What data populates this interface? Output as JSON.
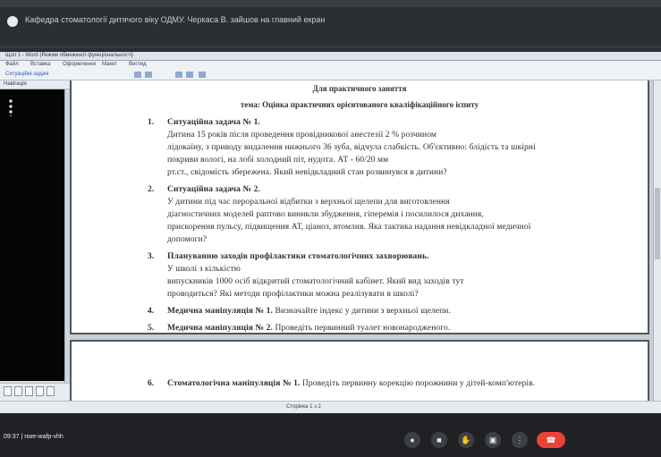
{
  "banner": {
    "text": "Кафедра стоматології дитячого віку ОДМУ. Черкаса В. зайшов на главний екран"
  },
  "window": {
    "title": "Щоп 1 - Word (Режим обмеженої функціональності)",
    "menu": [
      "Файл",
      "Вставка",
      "Оформлення",
      "Макет",
      "Вигляд"
    ],
    "toolbar_text": "Ситуаційні задачі",
    "side_header": "Навігація",
    "status_text": "Сторінка 1 з 2"
  },
  "document": {
    "page1_header_top": "Для практичного заняття",
    "page1_header": "тема: Оцінка практичних орієнтованого кваліфікаційного іспиту",
    "tasks": [
      {
        "num": "1.",
        "title": "Ситуаційна задача № 1.",
        "lines": [
          "Дитина 15 років після проведення провідникової анестезії 2 % розчином",
          "лідокаїну, з приводу видалення нижнього 36 зуба, відчула слабкість. Об'єктивно: блідість та шкірні",
          "покриви вологі, на лобі холодний піт, нудота. АТ - 60/20 мм",
          "рт.ст., свідомість збережена. Який невідкладний стан розвинувся в дитини?"
        ]
      },
      {
        "num": "2.",
        "title": "Ситуаційна задача № 2.",
        "lines": [
          "У дитини під час пероральної відбитки з верхньої щелепи для виготовлення",
          "діагностичних моделей раптово виникли збудження, гіперемія і посилилося дихання,",
          "прискорення пульсу, підвищення АТ, ціаноз, втомлив. Яка тактика надання невідкладної медичної",
          "допомоги?"
        ]
      },
      {
        "num": "3.",
        "title": "Плануванню заходів профілактики стоматологічних захворювань.",
        "lines": [
          "У школі з кількістю",
          "випускників 1000 осіб відкритий стоматологічний кабінет. Який вид заходів тут",
          "проводиться? Які методи профілактики можна реалізувати в школі?"
        ]
      },
      {
        "num": "4.",
        "title": "Медична маніпуляція № 1.",
        "lines": [
          "Визначайте індекс у дитини з верхньої щелепи."
        ]
      },
      {
        "num": "5.",
        "title": "Медична маніпуляція № 2.",
        "lines": [
          "Проведіть первинний туалет новонародженого."
        ]
      }
    ],
    "page2_tasks": [
      {
        "num": "6.",
        "title": "Стоматологічна маніпуляція № 1.",
        "lines": [
          "Проведіть первинну корекцію порожнини у дітей-комп'ютерів."
        ]
      }
    ]
  },
  "meeting": {
    "time_label": "09:37",
    "meeting_code": "nwe-wafp-vhh"
  },
  "controls": [
    {
      "name": "mic-button",
      "icon": "microphone-icon"
    },
    {
      "name": "camera-button",
      "icon": "camera-icon"
    },
    {
      "name": "raise-hand-button",
      "icon": "hand-icon"
    },
    {
      "name": "present-button",
      "icon": "present-icon"
    },
    {
      "name": "more-options-button",
      "icon": "more-vert-icon"
    }
  ],
  "colors": {
    "end_call": "#ea4335",
    "meet_bg": "#202124"
  }
}
